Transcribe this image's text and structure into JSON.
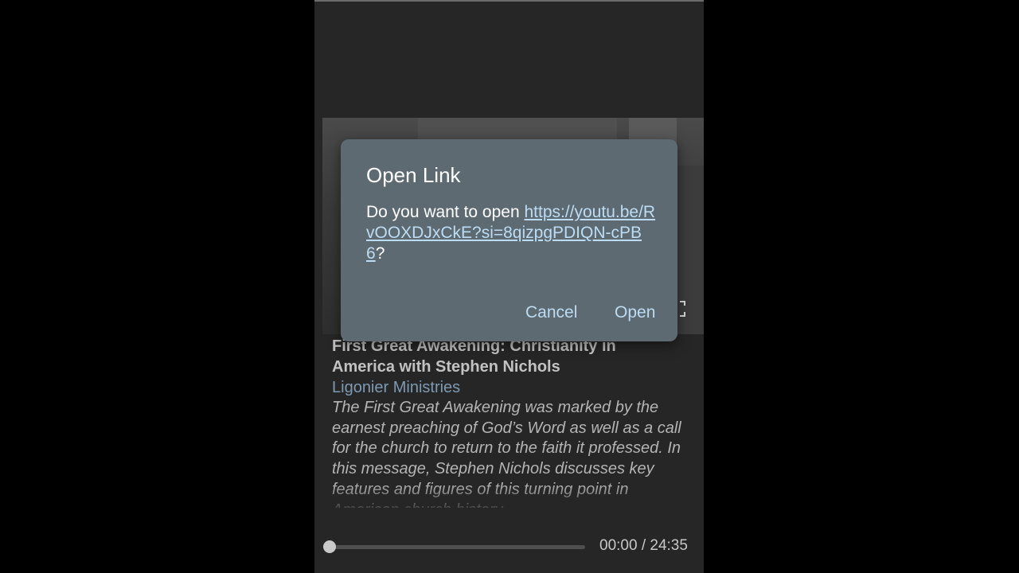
{
  "video": {
    "title": "First Great Awakening: Christianity in America with Stephen Nichols",
    "channel": "Ligonier Ministries",
    "description": "The First Great Awakening was marked by the earnest preaching of God’s Word as well as a call for the church to return to the faith it professed. In this message, Stephen Nichols discusses key features and figures of this turning point in American church history."
  },
  "player": {
    "time_display": "00:00 / 24:35",
    "progress_fraction": 0,
    "fullscreen_icon": "fullscreen-icon"
  },
  "dialog": {
    "title": "Open Link",
    "body_prefix": "Do you want to open ",
    "url": "https://youtu.be/RvOOXDJxCkE?si=8qizpgPDIQN-cPB6",
    "body_suffix": "?",
    "cancel_label": "Cancel",
    "open_label": "Open"
  },
  "colors": {
    "dialog_bg": "#5e6a72",
    "accent": "#bcdcf4",
    "channel": "#7d9ab3"
  }
}
